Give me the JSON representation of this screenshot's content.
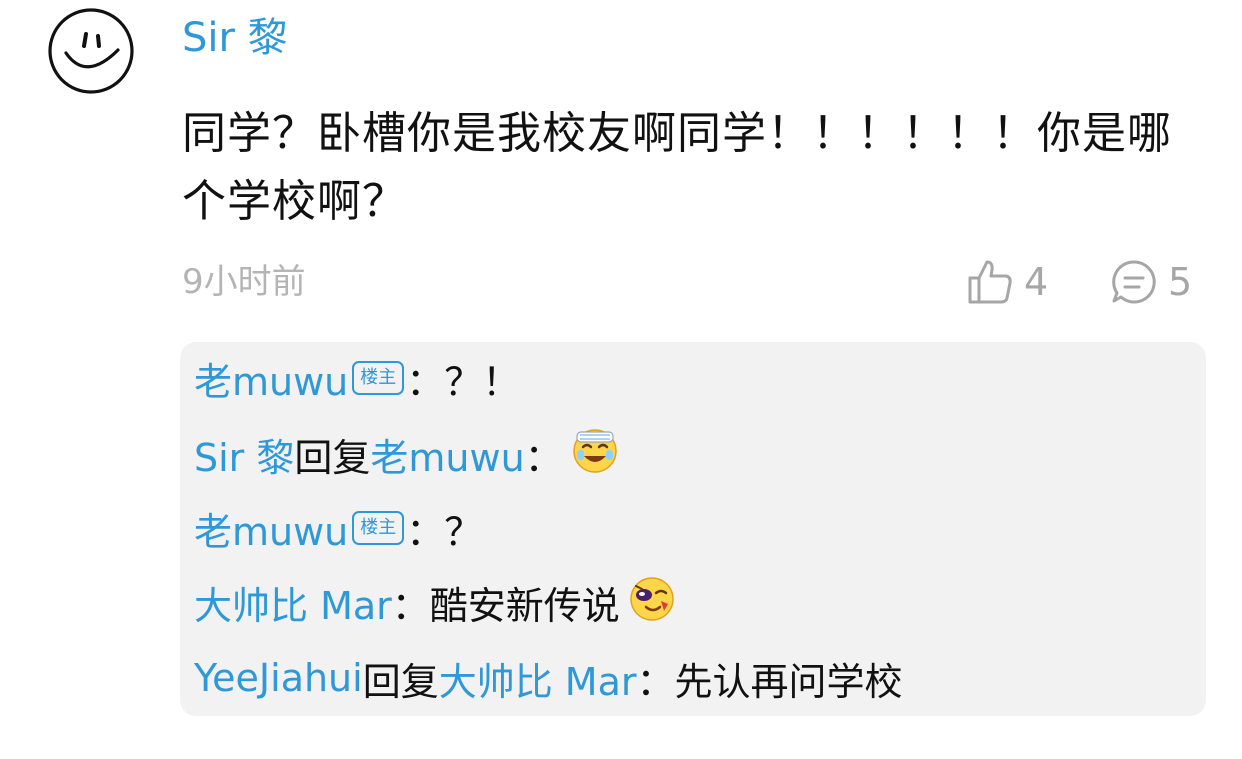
{
  "comment": {
    "username": "Sir 黎",
    "text": "同学？卧槽你是我校友啊同学！！！！！！你是哪个学校啊？",
    "time": "9小时前",
    "likes": "4",
    "reply_count": "5",
    "avatar_icon": "smiley-face-icon"
  },
  "replies": {
    "r1": {
      "name": "老muwu",
      "badge": "楼主",
      "sep": "：",
      "text": "？！"
    },
    "r2": {
      "name": "Sir 黎",
      "verb": "回复",
      "target": "老muwu",
      "sep": "：",
      "emoji": "laughing-tears-emoji-icon"
    },
    "r3": {
      "name": "老muwu",
      "badge": "楼主",
      "sep": "：",
      "text": "？"
    },
    "r4": {
      "name": "大帅比 Mar",
      "sep": "：",
      "text": "酷安新传说",
      "emoji": "winking-emoji-icon"
    },
    "r5": {
      "name": "YeeJiahui",
      "verb": "回复",
      "target": "大帅比 Mar",
      "sep": "：",
      "text": "先认再问学校"
    }
  },
  "colors": {
    "link": "#2e98d8",
    "text": "#111111",
    "muted": "#b4b4b4",
    "reply_bg": "#f2f2f2"
  }
}
